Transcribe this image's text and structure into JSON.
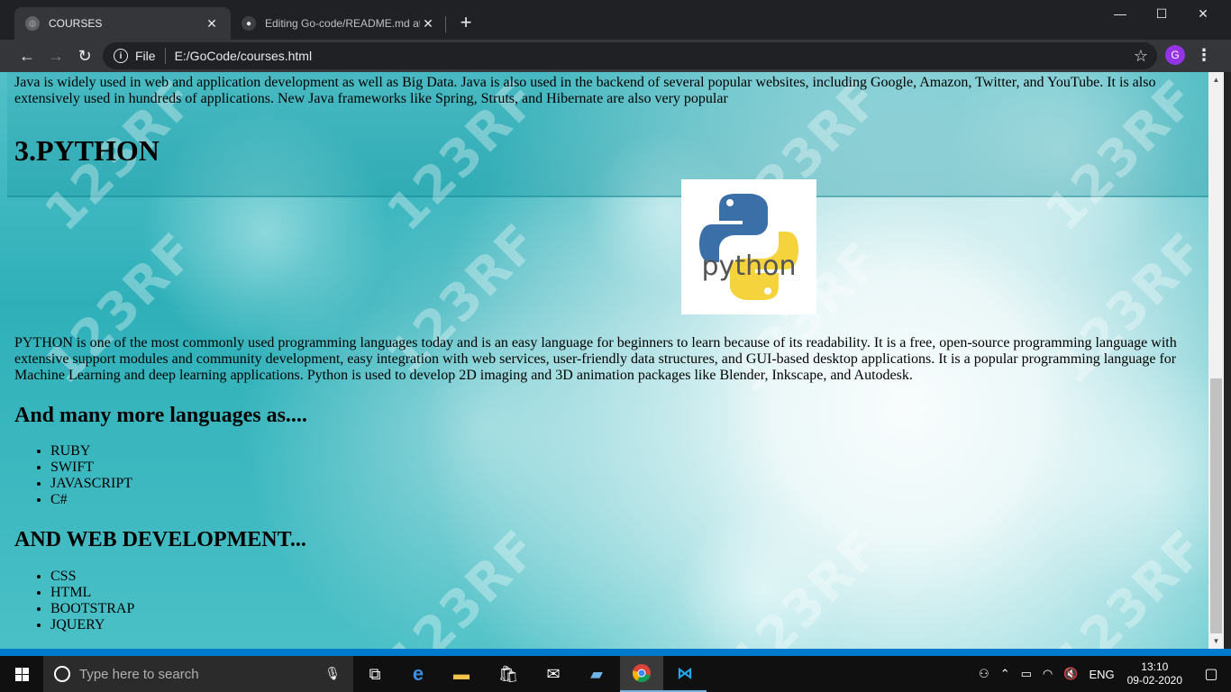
{
  "browser": {
    "tabs": [
      {
        "title": "COURSES",
        "close": "✕"
      },
      {
        "title": "Editing Go-code/README.md at",
        "close": "✕"
      }
    ],
    "new_tab": "+",
    "window_controls": {
      "minimize": "—",
      "maximize": "☐",
      "close": "✕"
    },
    "address": {
      "scheme": "File",
      "url": "E:/GoCode/courses.html"
    },
    "profile_initial": "G"
  },
  "page": {
    "java_paragraph": "Java is widely used in web and application development as well as Big Data. Java is also used in the backend of several popular websites, including Google, Amazon, Twitter, and YouTube. It is also extensively used in hundreds of applications. New Java frameworks like Spring, Struts, and Hibernate are also very popular",
    "python_heading": "3.PYTHON",
    "python_logo_text": "python",
    "python_paragraph": "PYTHON is one of the most commonly used programming languages today and is an easy language for beginners to learn because of its readability. It is a free, open-source programming language with extensive support modules and community development, easy integration with web services, user-friendly data structures, and GUI-based desktop applications. It is a popular programming language for Machine Learning and deep learning applications. Python is used to develop 2D imaging and 3D animation packages like Blender, Inkscape, and Autodesk.",
    "more_heading": "And many more languages as....",
    "languages": [
      "RUBY",
      "SWIFT",
      "JAVASCRIPT",
      "C#"
    ],
    "web_heading": "AND WEB DEVELOPMENT...",
    "web_items": [
      "CSS",
      "HTML",
      "BOOTSTRAP",
      "JQUERY"
    ],
    "watermark": "123RF"
  },
  "taskbar": {
    "search_placeholder": "Type here to search",
    "language": "ENG",
    "time": "13:10",
    "date": "09-02-2020"
  },
  "colors": {
    "chrome_dark": "#202124",
    "toolbar": "#35363a",
    "page_teal": "#2fb0b9",
    "avatar": "#9334e6",
    "vscode_blue": "#007acc"
  }
}
